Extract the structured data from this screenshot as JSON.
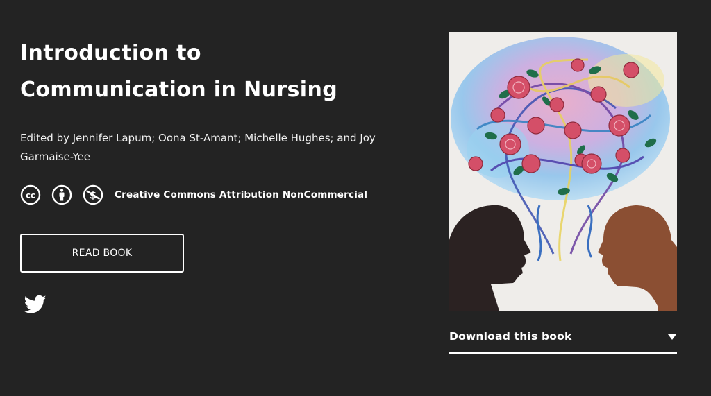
{
  "book": {
    "title_line1": "Introduction to",
    "title_line2": "Communication in Nursing",
    "authors": "Edited by Jennifer Lapum; Oona St-Amant; Michelle Hughes; and Joy Garmaise-Yee"
  },
  "license": {
    "label": "Creative Commons Attribution NonCommercial",
    "icons": [
      "cc-icon",
      "attribution-icon",
      "noncommercial-icon"
    ]
  },
  "actions": {
    "read_label": "READ BOOK",
    "download_label": "Download this book"
  },
  "social": {
    "icon": "twitter-icon"
  },
  "colors": {
    "background": "#232323",
    "text": "#ffffff"
  }
}
